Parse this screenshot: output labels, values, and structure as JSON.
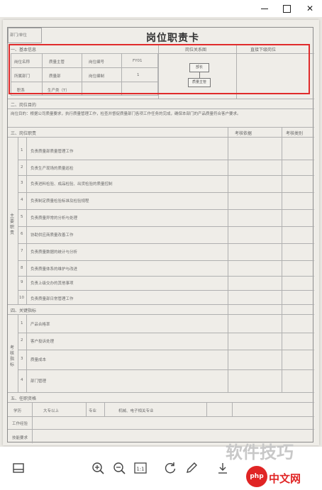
{
  "window": {
    "min": "",
    "max": "",
    "close": "✕"
  },
  "document": {
    "dept_label": "部门/单位",
    "title": "岗位职责卡",
    "basic": {
      "header": "一、基本信息",
      "fields": [
        [
          "岗位名称",
          "质量主管",
          "岗位编号",
          "FY01"
        ],
        [
          "所属部门",
          "质量部",
          "岗位编制",
          "1"
        ],
        [
          "职系",
          "生产类（T）",
          "",
          ""
        ]
      ],
      "org_header": "岗位关系图",
      "org_boxes": [
        "部长",
        "质量主管"
      ],
      "right_header": "直接下级岗位"
    },
    "purpose": {
      "header": "二、岗位目的",
      "text": "岗位目的：根据公司质量要求，执行质量管理工作，检查并督促质量部门各项工作任务的完成，确保本部门的产品质量符合客户要求。"
    },
    "duties": {
      "header": "三、岗位职责",
      "col_basis": "考核依据",
      "col_type": "考核类别",
      "side_label": "主要职责",
      "rows": [
        [
          "1",
          "负责质量部质量管理工作"
        ],
        [
          "2",
          "负责生产现场的质量巡检"
        ],
        [
          "3",
          "负责进料检验、成品检验、出货检验的质量控制"
        ],
        [
          "4",
          "负责制定质量检验标准及检验规程"
        ],
        [
          "5",
          "负责质量异常的分析与处理"
        ],
        [
          "6",
          "协助供应商质量改善工作"
        ],
        [
          "7",
          "负责质量数据的统计与分析"
        ],
        [
          "8",
          "负责质量体系的维护与改进"
        ],
        [
          "9",
          "负责上级交办的其他事项"
        ],
        [
          "10",
          "负责质量部日常管理工作"
        ]
      ]
    },
    "kpi": {
      "header": "四、关键指标",
      "side_label": "考核指标",
      "rows": [
        [
          "1",
          "产品合格率"
        ],
        [
          "2",
          "客户投诉处理"
        ],
        [
          "3",
          "质量成本"
        ],
        [
          "4",
          "部门管理"
        ]
      ]
    },
    "qualify": {
      "header": "五、任职资格",
      "education_label": "学历",
      "education_value": "大专以上",
      "major_label": "专业",
      "major_value": "机械、电子相关专业",
      "exp_label": "工作经验",
      "skill_label": "技能要求"
    }
  },
  "toolbar": {
    "items": [
      "sidebar-icon",
      "zoom-in-icon",
      "zoom-out-icon",
      "actual-size-icon",
      "rotate-icon",
      "edit-icon",
      "download-icon"
    ],
    "actual_size_label": "1:1"
  },
  "watermark": {
    "text": "软件技巧",
    "logo": "php",
    "url": "中文网"
  }
}
